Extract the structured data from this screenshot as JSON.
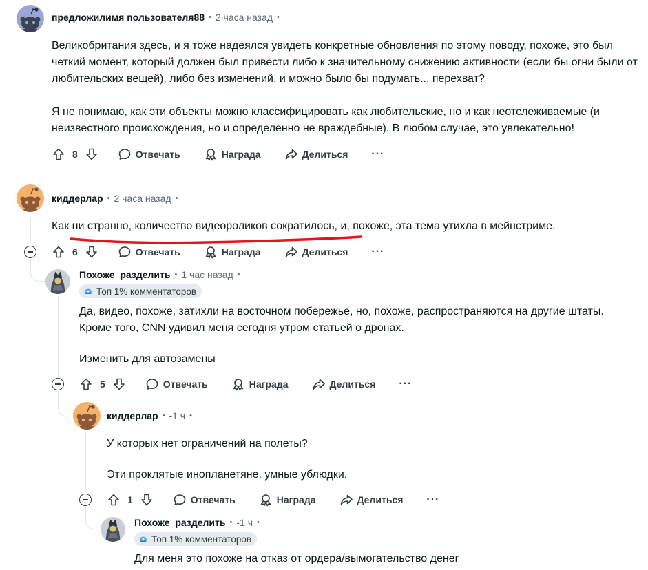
{
  "comments": [
    {
      "author": "предложилимя пользователя88",
      "time": "2 часа назад",
      "paragraphs": [
        "Великобритания здесь, и я тоже надеялся увидеть конкретные обновления по этому поводу, похоже, это был четкий момент, который должен был привести либо к значительному снижению активности (если бы огни были от любительских вещей), либо без изменений, и можно было бы подумать... перехват?",
        "Я не понимаю, как эти объекты можно классифицировать как любительские, но и как неотслеживаемые (и неизвестного происхождения, но и определенно не враждебные). В любом случае, это увлекательно!"
      ],
      "votes": "8"
    },
    {
      "author": "киддерлар",
      "time": "2 часа назад",
      "paragraphs": [
        "Как ни странно, количество видеороликов сократилось, и, похоже, эта тема утихла в мейнстриме."
      ],
      "votes": "6"
    },
    {
      "author": "Похоже_разделить",
      "time": "1 час назад",
      "badge": "Топ 1% комментаторов",
      "paragraphs": [
        "Да, видео, похоже, затихли на восточном побережье, но, похоже, распространяются на другие штаты. Кроме того, CNN удивил меня сегодня утром статьей о дронах.",
        "Изменить для автозамены"
      ],
      "votes": "5"
    },
    {
      "author": "киддерлар",
      "time": "-1 ч",
      "paragraphs": [
        "У которых нет ограничений на полеты?",
        "Эти проклятые инопланетяне, умные ублюдки."
      ],
      "votes": "1"
    },
    {
      "author": "Похоже_разделить",
      "time": "-1 ч",
      "badge": "Топ 1% комментаторов",
      "paragraphs": [
        "Для меня это похоже на отказ от ордера/вымогательство денег"
      ]
    }
  ],
  "labels": {
    "reply": "Отвечать",
    "award": "Награда",
    "share": "Делиться",
    "more": "···"
  },
  "colors": {
    "annotation": "#e8141c",
    "thread_line": "#e0e6e9",
    "badge_bg": "#e5ebee"
  },
  "icons": [
    "upvote-icon",
    "downvote-icon",
    "reply-icon",
    "award-icon",
    "share-icon",
    "more-icon",
    "collapse-icon",
    "snoo-avatar",
    "badge-icon"
  ]
}
